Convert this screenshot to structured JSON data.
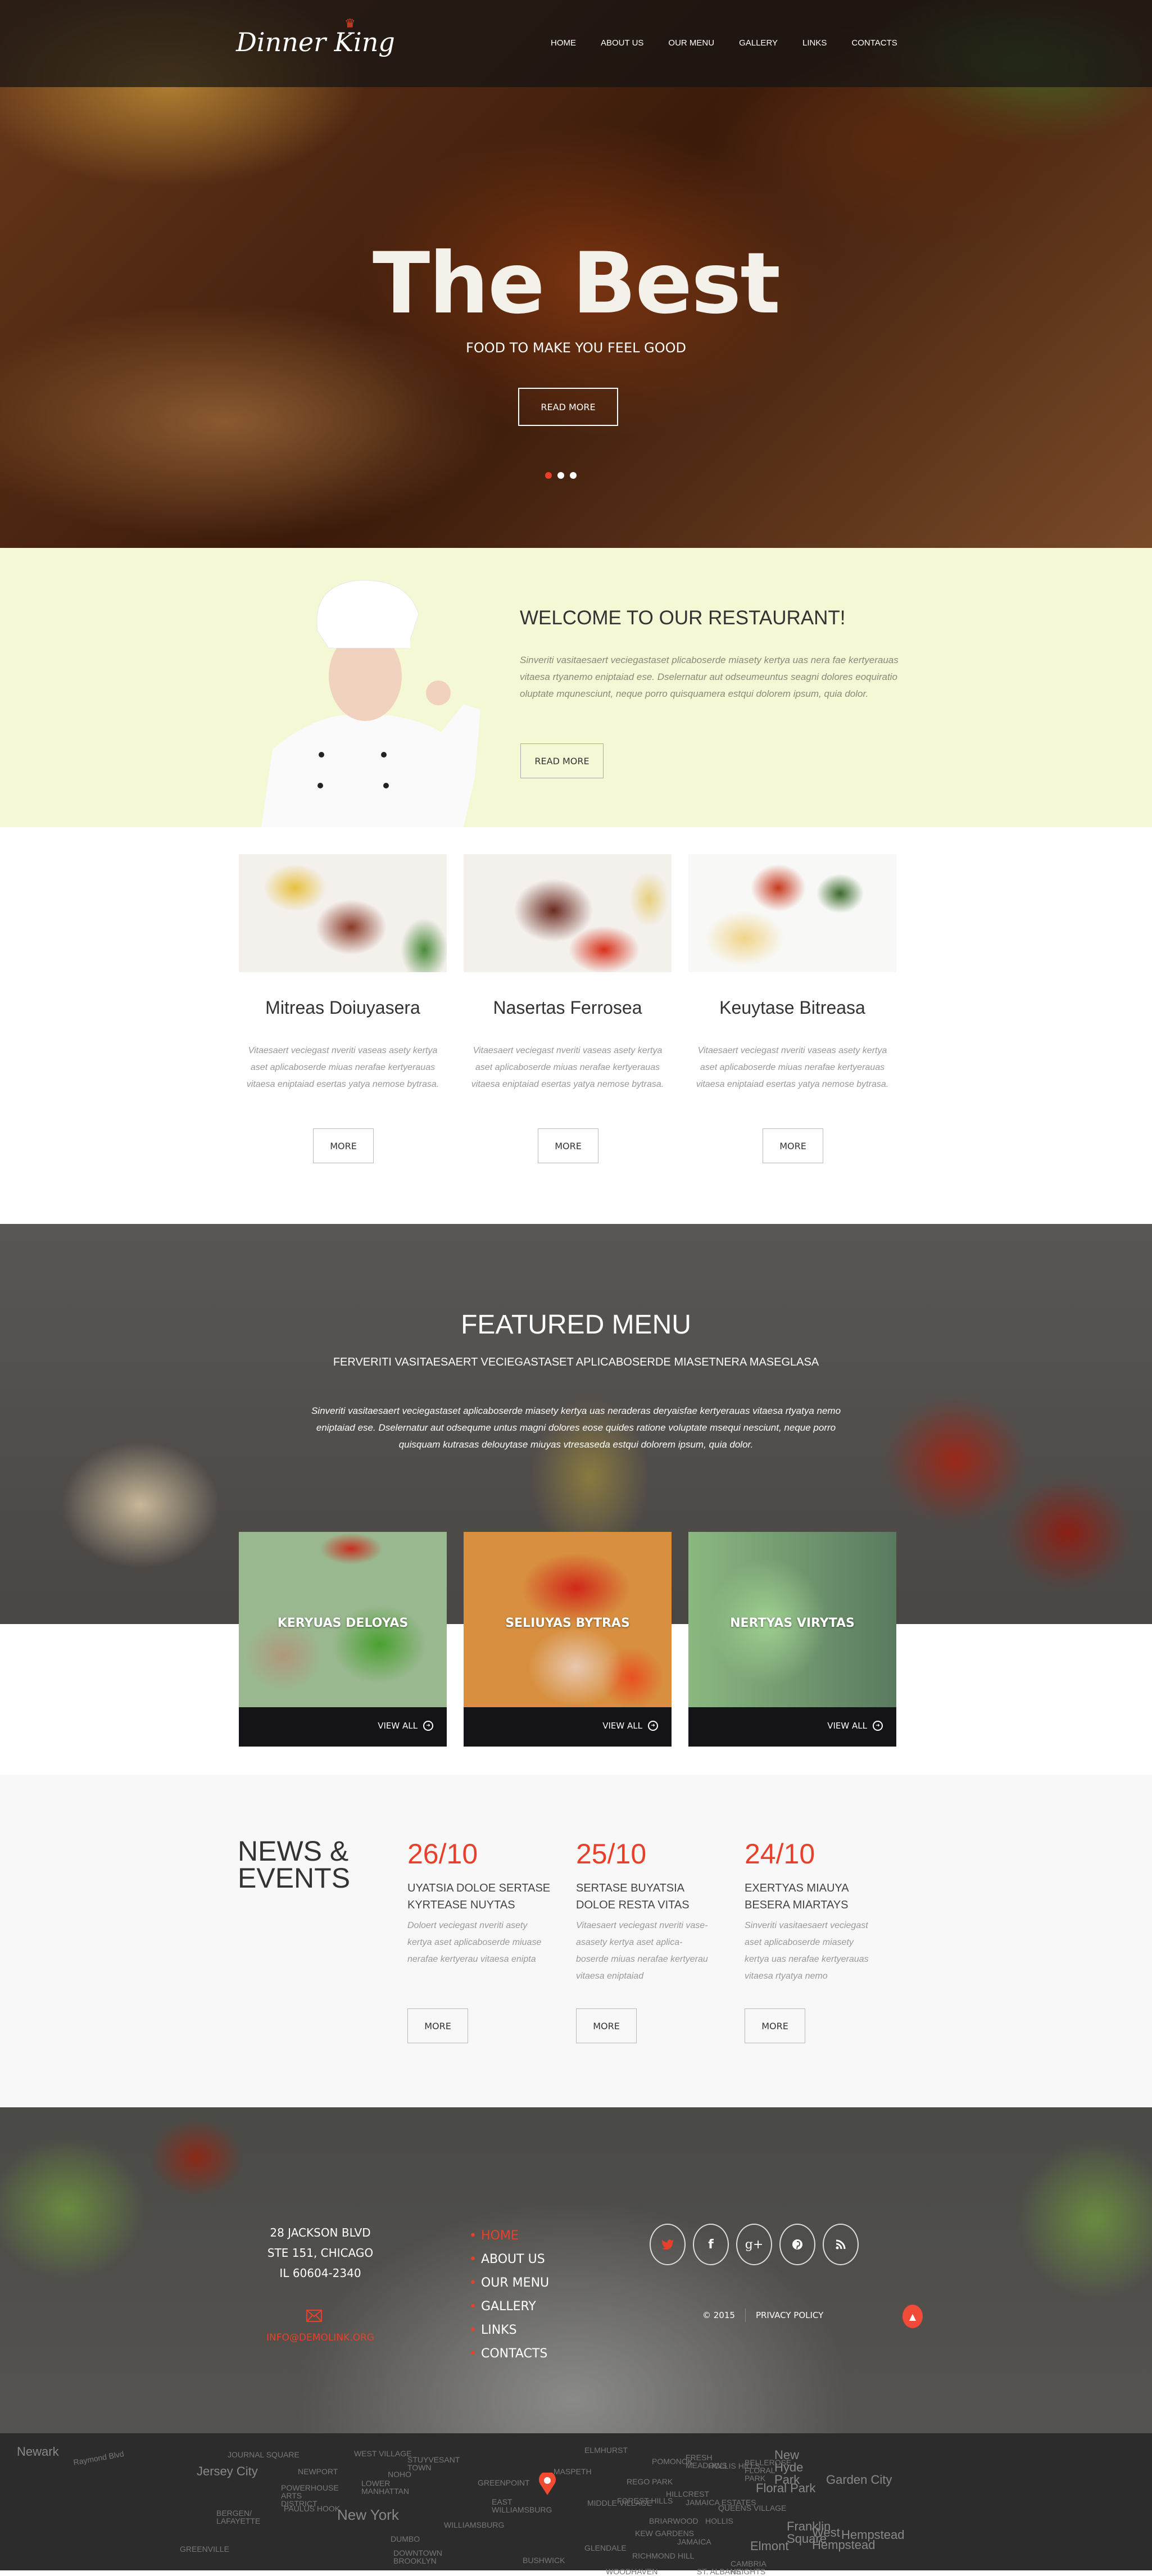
{
  "brand": {
    "name": "Dinner King",
    "accent": "#e8402a"
  },
  "nav": {
    "items": [
      "HOME",
      "ABOUT US",
      "OUR MENU",
      "GALLERY",
      "LINKS",
      "CONTACTS"
    ]
  },
  "hero": {
    "title": "The Best",
    "subtitle": "FOOD TO MAKE YOU FEEL GOOD",
    "button": "READ MORE",
    "slides": 3,
    "active_slide": 1
  },
  "welcome": {
    "title": "WELCOME TO OUR RESTAURANT!",
    "text": "Sinveriti vasitaesaert veciegastaset plicaboserde miasety kertya uas nera fae kertyerauas vitaesa rtyanemo eniptaiad ese. Dselernatur aut odseumeuntus seagni dolores eoquiratio oluptate mqunesciunt, neque porro quisquamera estqui dolorem ipsum, quia dolor.",
    "button": "READ MORE"
  },
  "dishes": [
    {
      "title": "Mitreas Doiuyasera",
      "text": "Vitaesaert veciegast nveriti vaseas asety kertya aset aplicaboserde miuas nerafae kertyerauas vitaesa eniptaiad esertas yatya nemose bytrasa.",
      "button": "MORE"
    },
    {
      "title": "Nasertas Ferrosea",
      "text": "Vitaesaert veciegast nveriti vaseas asety kertya aset aplicaboserde miuas nerafae kertyerauas vitaesa eniptaiad esertas yatya nemose bytrasa.",
      "button": "MORE"
    },
    {
      "title": "Keuytase Bitreasa",
      "text": "Vitaesaert veciegast nveriti vaseas asety kertya aset aplicaboserde miuas nerafae kertyerauas vitaesa eniptaiad esertas yatya nemose bytrasa.",
      "button": "MORE"
    }
  ],
  "featured": {
    "title": "FEATURED MENU",
    "subtitle": "FERVERITI VASITAESAERT VECIEGASTASET APLICABOSERDE MIASETNERA MASEGLASA",
    "text": "Sinveriti vasitaesaert veciegastaset aplicaboserde miasety kertya uas neraderas deryaisfae kertyerauas vitaesa rtyatya nemo eniptaiad ese. Dselernatur aut odsequme untus magni dolores eose quides ratione voluptate msequi nesciunt, neque porro quisquam kutrasas delouytase miuyas vtresaseda estqui dolorem ipsum, quia dolor.",
    "cards": [
      {
        "label": "KERYUAS DELOYAS",
        "link": "VIEW ALL"
      },
      {
        "label": "SELIUYAS BYTRAS",
        "link": "VIEW ALL"
      },
      {
        "label": "NERTYAS VIRYTAS",
        "link": "VIEW ALL"
      }
    ]
  },
  "news": {
    "heading_line1": "NEWS &",
    "heading_line2": "EVENTS",
    "items": [
      {
        "date": "26/10",
        "title": "UYATSIA DOLOE SERTASE KYRTEASE NUYTAS",
        "text": "Doloert veciegast nveriti asety kertya aset aplicaboserde miuase nerafae kertyerau vitaesa enipta",
        "button": "MORE"
      },
      {
        "date": "25/10",
        "title": "SERTASE BUYATSIA DOLOE RESTA VITAS",
        "text": "Vitaesaert veciegast nveriti vase-asasety kertya aset aplica-boserde miuas nerafae kertyerau vitaesa eniptaiad",
        "button": "MORE"
      },
      {
        "date": "24/10",
        "title": "EXERTYAS MIAUYA BESERA MIARTAYS",
        "text": "Sinveriti vasitaesaert veciegast aset aplicaboserde miasety kertya uas nerafae kertyerauas vitaesa rtyatya nemo",
        "button": "MORE"
      }
    ]
  },
  "footer": {
    "address": [
      "28 JACKSON BLVD",
      "STE 151, CHICAGO",
      "IL 60604-2340"
    ],
    "email": "INFO@DEMOLINK.ORG",
    "nav": [
      "HOME",
      "ABOUT US",
      "OUR MENU",
      "GALLERY",
      "LINKS",
      "CONTACTS"
    ],
    "nav_active": "HOME",
    "social": [
      {
        "icon": "twitter-icon",
        "glyph": "t"
      },
      {
        "icon": "facebook-icon",
        "glyph": "f"
      },
      {
        "icon": "google-plus-icon",
        "glyph": "g+"
      },
      {
        "icon": "pinterest-icon",
        "glyph": "p"
      },
      {
        "icon": "rss-icon",
        "glyph": ")))"
      }
    ],
    "copyright": "© 2015",
    "privacy": "PRIVACY POLICY"
  },
  "map": {
    "labels": [
      "Newark",
      "Raymond Blvd",
      "Jersey City",
      "JOURNAL SQUARE",
      "NEWPORT",
      "POWERHOUSE ARTS DISTRICT",
      "PAULUS HOOK",
      "BERGEN/ LAFAYETTE",
      "GREENVILLE",
      "New York",
      "WEST VILLAGE",
      "STUYVESANT TOWN",
      "NOHO",
      "LOWER MANHATTAN",
      "DUMBO",
      "DOWNTOWN BROOKLYN",
      "GREENPOINT",
      "EAST WILLIAMSBURG",
      "WILLIAMSBURG",
      "MASPETH",
      "BUSHWICK",
      "ELMHURST",
      "REGO PARK",
      "MIDDLE VILLAGE",
      "FOREST HILLS",
      "POMONOK",
      "FRESH MEADOWS",
      "HOLLIS HILLS",
      "HILLCREST",
      "JAMAICA ESTATES",
      "BRIARWOOD",
      "KEW GARDENS",
      "JAMAICA",
      "HOLLIS",
      "QUEENS VILLAGE",
      "BELLEROSE FLORAL PARK",
      "Floral Park",
      "New Hyde Park",
      "Garden City",
      "Franklin Square",
      "West Hempstead",
      "Hempstead",
      "Elmont",
      "RICHMOND HILL",
      "GLENDALE",
      "WOODHAVEN",
      "ST. ALBANS",
      "CAMBRIA HEIGHTS"
    ]
  }
}
